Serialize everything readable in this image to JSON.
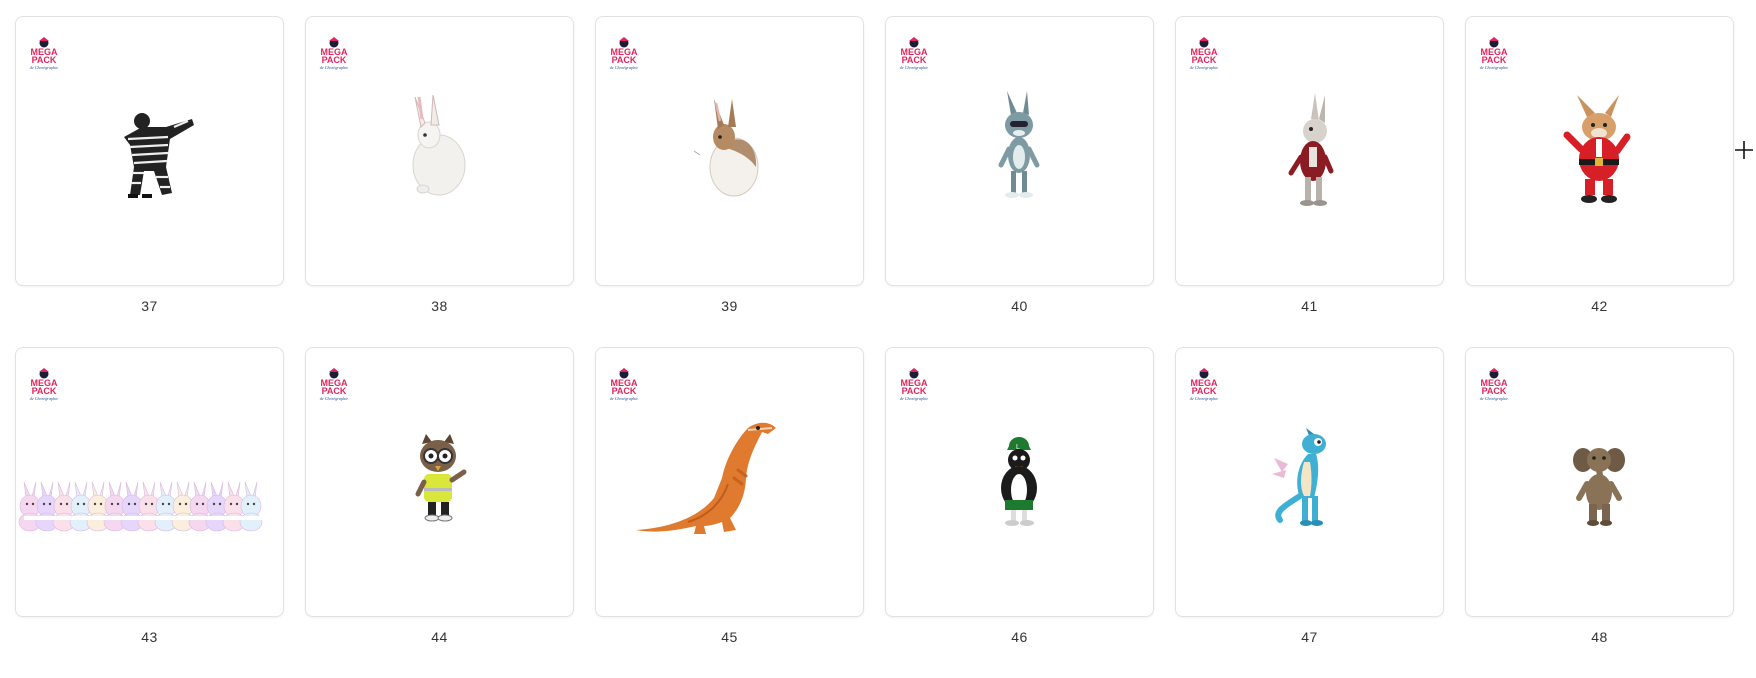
{
  "logo": {
    "line1": "MEGA",
    "line2": "PACK",
    "line3": "de Chorégraphie",
    "colors": {
      "text": "#e0245e",
      "script": "#1f4fa3",
      "mascot": "#1d1d3a"
    }
  },
  "tiles": [
    {
      "number": "37",
      "image": "dancer-striped-suit-icon",
      "variant": "striped"
    },
    {
      "number": "38",
      "image": "white-rabbit-icon",
      "variant": "rabbit-white"
    },
    {
      "number": "39",
      "image": "brown-white-rabbit-icon",
      "variant": "rabbit-brown"
    },
    {
      "number": "40",
      "image": "gray-cartoon-bunny-icon",
      "variant": "bunny-gray"
    },
    {
      "number": "41",
      "image": "bunny-in-red-jacket-icon",
      "variant": "bunny-jacket"
    },
    {
      "number": "42",
      "image": "santa-bunny-icon",
      "variant": "bunny-santa"
    },
    {
      "number": "43",
      "image": "bunny-crowd-icon",
      "variant": "bunny-crowd"
    },
    {
      "number": "44",
      "image": "owl-in-safety-vest-icon",
      "variant": "owl"
    },
    {
      "number": "45",
      "image": "inflatable-trex-icon",
      "variant": "trex"
    },
    {
      "number": "46",
      "image": "penguin-with-cap-icon",
      "variant": "penguin"
    },
    {
      "number": "47",
      "image": "blue-dragon-icon",
      "variant": "dragon"
    },
    {
      "number": "48",
      "image": "elephant-icon",
      "variant": "elephant"
    }
  ],
  "cursor": {
    "icon": "crosshair-cursor-icon"
  }
}
